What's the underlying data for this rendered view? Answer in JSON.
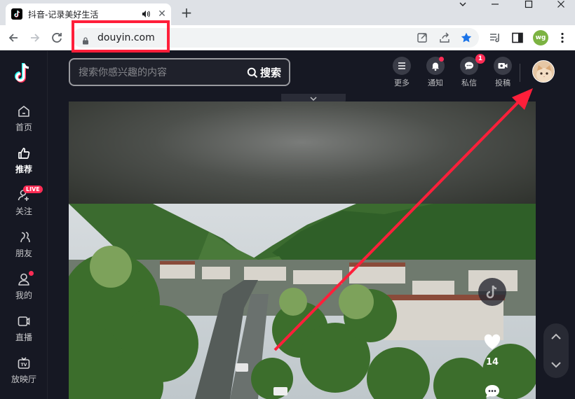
{
  "browser": {
    "tab_title": "抖音-记录美好生活",
    "tab_close": "✕",
    "new_tab": "+",
    "url": "douyin.com",
    "profile_initials": "wg",
    "window_controls": [
      "⌄",
      "—",
      "☐",
      "✕"
    ]
  },
  "sidebar": {
    "items": [
      {
        "label": "首页",
        "icon": "home-icon"
      },
      {
        "label": "推荐",
        "icon": "thumbs-up-icon",
        "active": true
      },
      {
        "label": "关注",
        "icon": "follow-icon",
        "badge": "LIVE"
      },
      {
        "label": "朋友",
        "icon": "friends-icon"
      },
      {
        "label": "我的",
        "icon": "user-icon",
        "dot": true
      },
      {
        "label": "直播",
        "icon": "live-tv-icon"
      },
      {
        "label": "放映厅",
        "icon": "cinema-tv-icon"
      }
    ]
  },
  "search": {
    "placeholder": "搜索你感兴趣的内容",
    "button_label": "搜索"
  },
  "header": {
    "more_label": "更多",
    "notify_label": "通知",
    "message_label": "私信",
    "message_badge": "1",
    "upload_label": "投稿"
  },
  "video": {
    "like_count": "14"
  },
  "colors": {
    "accent": "#fe2c55",
    "annotation": "#ff1f3a",
    "background": "#161823"
  }
}
